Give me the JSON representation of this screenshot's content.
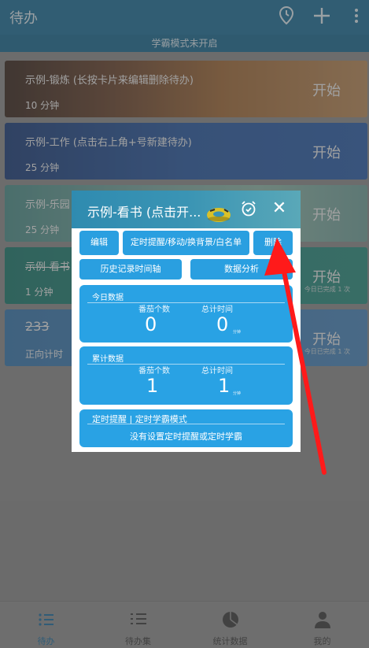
{
  "topbar": {
    "title": "待办",
    "mode_text": "学霸模式未开启"
  },
  "cards": [
    {
      "title": "示例-锻炼 (长按卡片来编辑删除待办)",
      "time": "10 分钟",
      "start": "开始"
    },
    {
      "title": "示例-工作 (点击右上角+号新建待办)",
      "time": "25 分钟",
      "start": "开始"
    },
    {
      "title": "示例-乐园",
      "time": "25 分钟",
      "start": "开始"
    },
    {
      "title": "示例-看书",
      "time": "1 分钟",
      "start": "开始",
      "done": "今日已完成 1 次"
    },
    {
      "title": "233",
      "time": "正向计时",
      "start": "开始",
      "done": "今日已完成 1 次"
    }
  ],
  "dialog": {
    "title": "示例-看书 (点击开...",
    "buttons": {
      "edit": "编辑",
      "settings": "定时提醒/移动/换背景/白名单",
      "delete": "删除",
      "history": "历史记录时间轴",
      "analysis": "数据分析"
    },
    "today": {
      "title": "今日数据",
      "count_label": "番茄个数",
      "count_value": "0",
      "time_label": "总计时间",
      "time_value": "0",
      "unit": "分钟"
    },
    "total": {
      "title": "累计数据",
      "count_label": "番茄个数",
      "count_value": "1",
      "time_label": "总计时间",
      "time_value": "1",
      "unit": "分钟"
    },
    "reminder": {
      "title": "定时提醒 | 定时学霸模式",
      "text": "没有设置定时提醒或定时学霸"
    }
  },
  "bottomnav": [
    {
      "label": "待办",
      "icon": "list-icon",
      "active": true
    },
    {
      "label": "待办集",
      "icon": "checklist-icon",
      "active": false
    },
    {
      "label": "统计数据",
      "icon": "pie-chart-icon",
      "active": false
    },
    {
      "label": "我的",
      "icon": "person-icon",
      "active": false
    }
  ],
  "colors": {
    "topbar": "#1f6f97",
    "dialog_button": "#2a9fe0",
    "arrow": "#ff1a1a"
  }
}
